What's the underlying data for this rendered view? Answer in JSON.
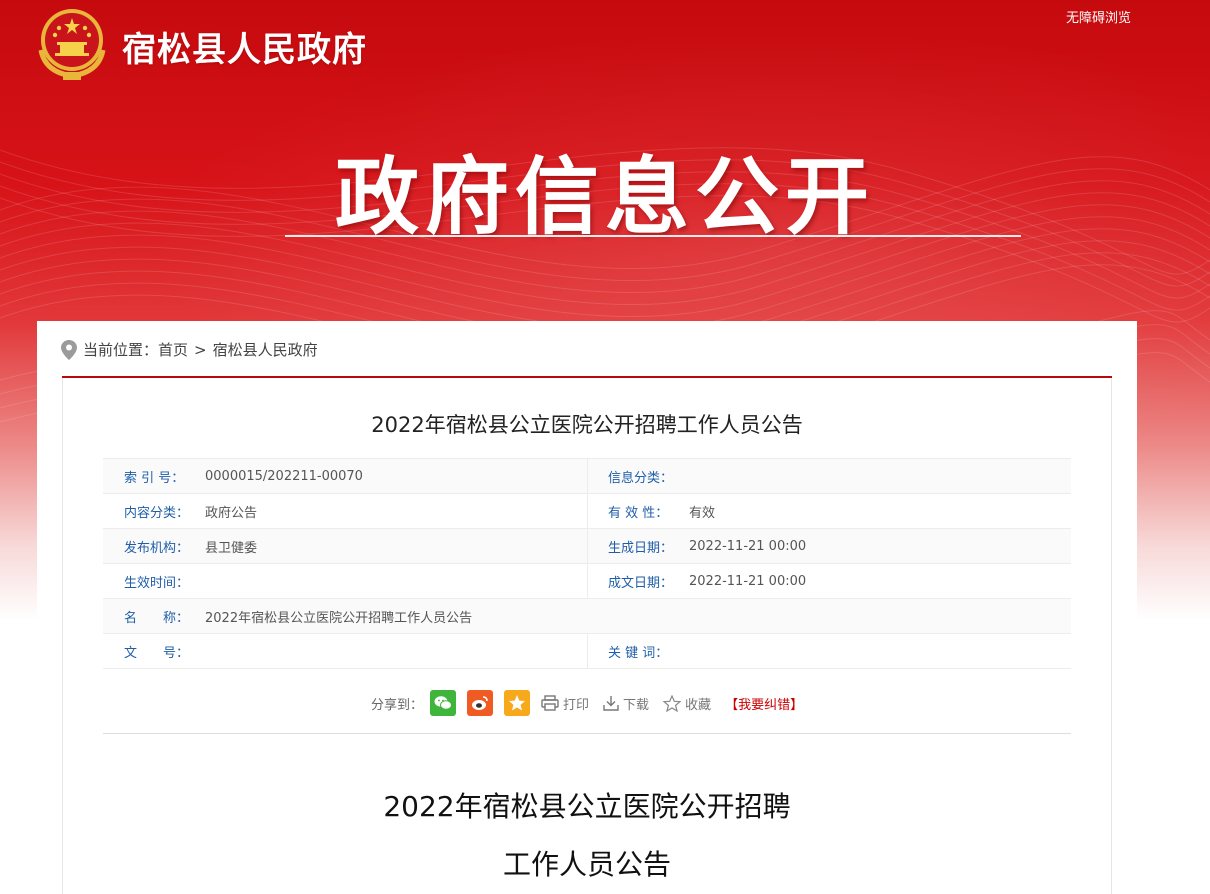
{
  "header": {
    "site_name": "宿松县人民政府",
    "accessibility_link": "无障碍浏览",
    "banner_title": "政府信息公开"
  },
  "breadcrumb": {
    "prefix": "当前位置：",
    "items": [
      "首页",
      "宿松县人民政府"
    ],
    "separator": ">"
  },
  "article": {
    "title": "2022年宿松县公立医院公开招聘工作人员公告",
    "body_title_line1": "2022年宿松县公立医院公开招聘",
    "body_title_line2": "工作人员公告"
  },
  "meta": {
    "index_label": "索 引 号：",
    "index_value": "0000015/202211-00070",
    "info_cat_label": "信息分类：",
    "info_cat_value": "",
    "content_cat_label": "内容分类：",
    "content_cat_value": "政府公告",
    "validity_label": "有 效 性：",
    "validity_value": "有效",
    "publisher_label": "发布机构：",
    "publisher_value": "县卫健委",
    "gen_date_label": "生成日期：",
    "gen_date_value": "2022-11-21 00:00",
    "effective_label": "生效时间：",
    "effective_value": "",
    "written_date_label": "成文日期：",
    "written_date_value": "2022-11-21 00:00",
    "name_label": "名　　称：",
    "name_value": "2022年宿松县公立医院公开招聘工作人员公告",
    "doc_no_label": "文　　号：",
    "doc_no_value": "",
    "keywords_label": "关 键 词：",
    "keywords_value": ""
  },
  "share": {
    "label": "分享到：",
    "print": "打印",
    "download": "下载",
    "favorite": "收藏",
    "report": "【我要纠错】"
  },
  "colors": {
    "brand_red": "#c50a0e",
    "label_blue": "#1f5ea8",
    "wechat": "#3fb53b",
    "weibo": "#f05a23",
    "qzone": "#f7a81b"
  },
  "icons": [
    "national-emblem-icon",
    "location-pin-icon",
    "wechat-icon",
    "weibo-icon",
    "qzone-star-icon",
    "printer-icon",
    "download-icon",
    "star-outline-icon"
  ]
}
